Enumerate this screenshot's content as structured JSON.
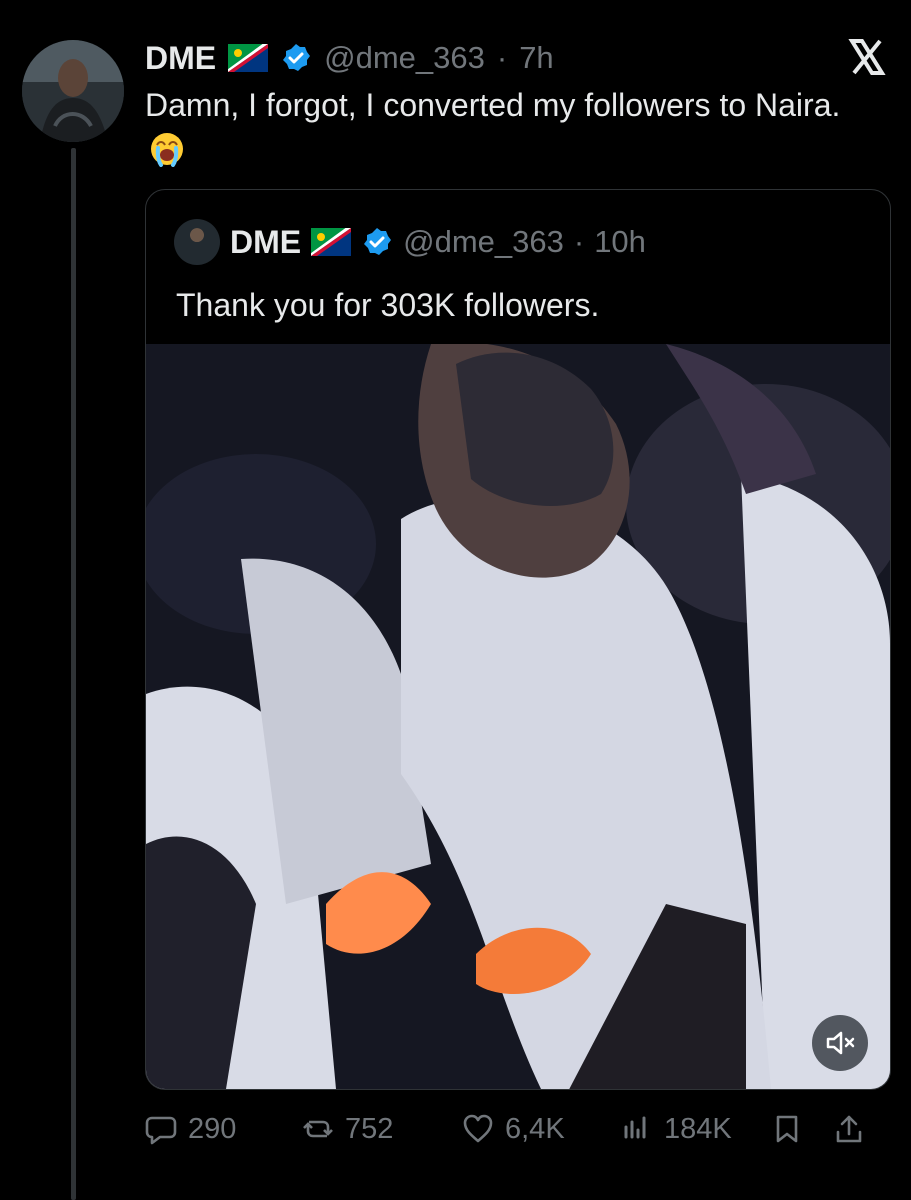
{
  "tweet": {
    "author_name": "DME",
    "handle": "@dme_363",
    "separator": "·",
    "time": "7h",
    "text": "Damn, I forgot, I converted my followers to Naira."
  },
  "quote": {
    "author_name": "DME",
    "handle": "@dme_363",
    "separator": "·",
    "time": "10h",
    "text": "Thank you for 303K followers."
  },
  "actions": {
    "replies": "290",
    "reposts": "752",
    "likes": "6,4K",
    "views": "184K"
  },
  "icons": [
    "flag-namibia-icon",
    "verified-badge-icon",
    "x-logo-icon",
    "crying-face-emoji-icon",
    "mute-icon",
    "reply-icon",
    "repost-icon",
    "like-icon",
    "views-icon",
    "bookmark-icon",
    "share-icon"
  ],
  "colors": {
    "background": "#000000",
    "text": "#e7e9ea",
    "muted": "#71767b",
    "verified": "#1d9bf0"
  }
}
